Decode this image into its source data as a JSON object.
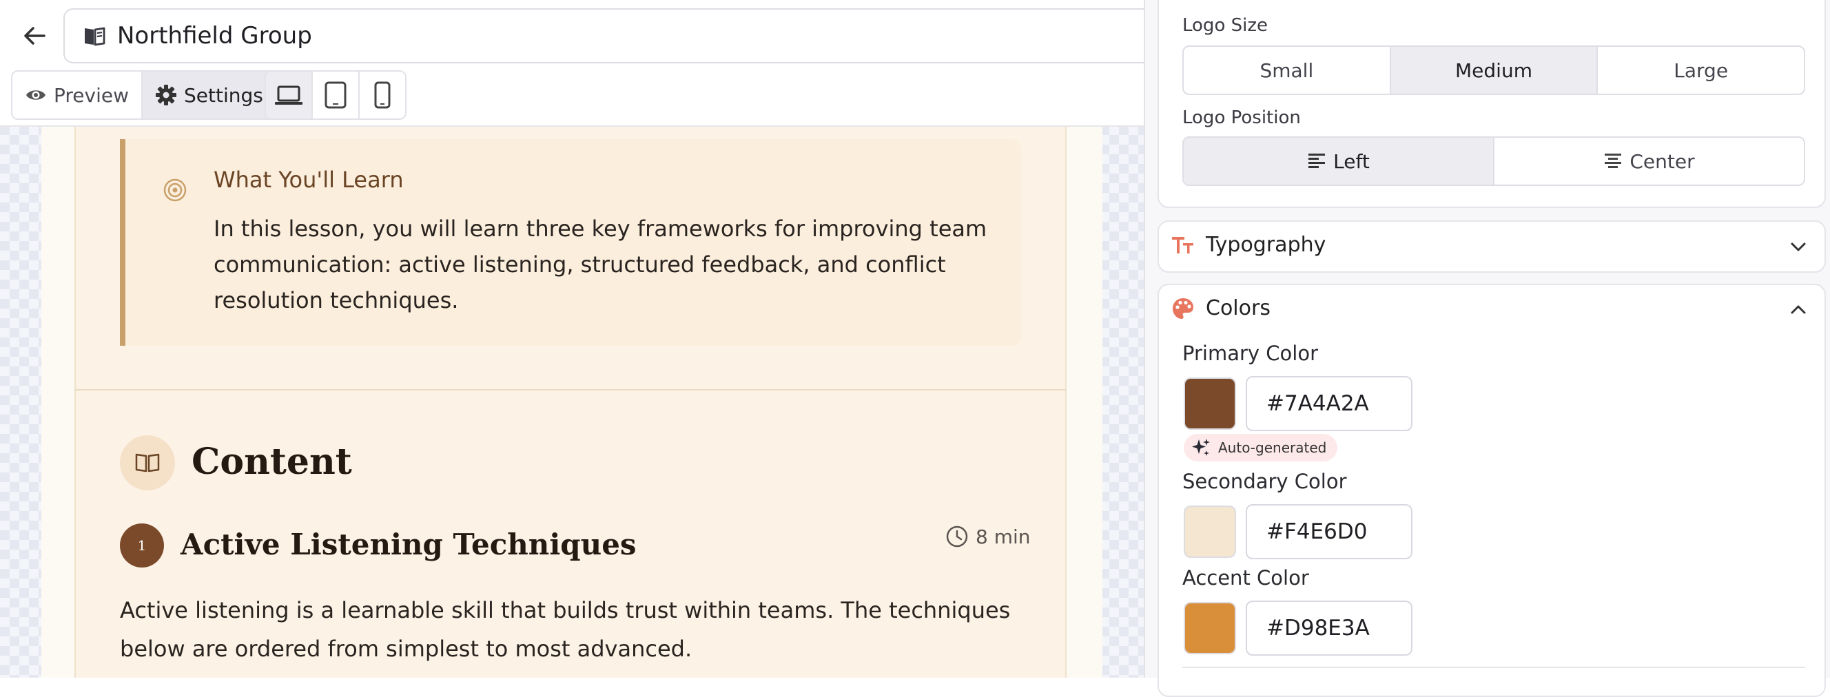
{
  "header": {
    "title": "Northfield Group",
    "modes": {
      "preview": "Preview",
      "settings": "Settings"
    },
    "active_mode": "settings",
    "active_device": "desktop"
  },
  "lesson": {
    "learn": {
      "title": "What You'll Learn",
      "text": "In this lesson, you will learn three key frameworks for improving team communication: active listening, structured feedback, and conflict resolution techniques."
    },
    "content_heading": "Content",
    "section": {
      "number": "1",
      "title": "Active Listening Techniques",
      "duration": "8 min",
      "text": "Active listening is a learnable skill that builds trust within teams. The techniques below are ordered from simplest to most advanced."
    }
  },
  "settings": {
    "logo_size": {
      "label": "Logo Size",
      "options": [
        "Small",
        "Medium",
        "Large"
      ],
      "selected": "Medium"
    },
    "logo_position": {
      "label": "Logo Position",
      "options": [
        "Left",
        "Center"
      ],
      "selected": "Left"
    },
    "typography": {
      "label": "Typography"
    },
    "colors": {
      "label": "Colors",
      "auto_badge": "Auto-generated",
      "primary": {
        "label": "Primary Color",
        "value": "#7A4A2A",
        "swatch": "#7a4a2a"
      },
      "secondary": {
        "label": "Secondary Color",
        "value": "#F4E6D0",
        "swatch": "#f4e6d0"
      },
      "accent": {
        "label": "Accent Color",
        "value": "#D98E3A",
        "swatch": "#d98e3a"
      }
    }
  },
  "icons": {
    "back": "arrow-left-icon",
    "book": "book-open-icon",
    "eye": "eye-icon",
    "gear": "gear-icon",
    "laptop": "laptop-icon",
    "tablet": "tablet-icon",
    "phone": "phone-icon",
    "target": "target-icon",
    "clock": "clock-icon",
    "align_left": "align-left-icon",
    "align_center": "align-center-icon",
    "typography": "text-size-icon",
    "palette": "palette-icon",
    "sparkles": "sparkles-icon",
    "chevron_down": "chevron-down-icon",
    "chevron_up": "chevron-up-icon"
  },
  "theme": {
    "accent_icon": "#e8765e",
    "brand": "#7a4a2a"
  }
}
